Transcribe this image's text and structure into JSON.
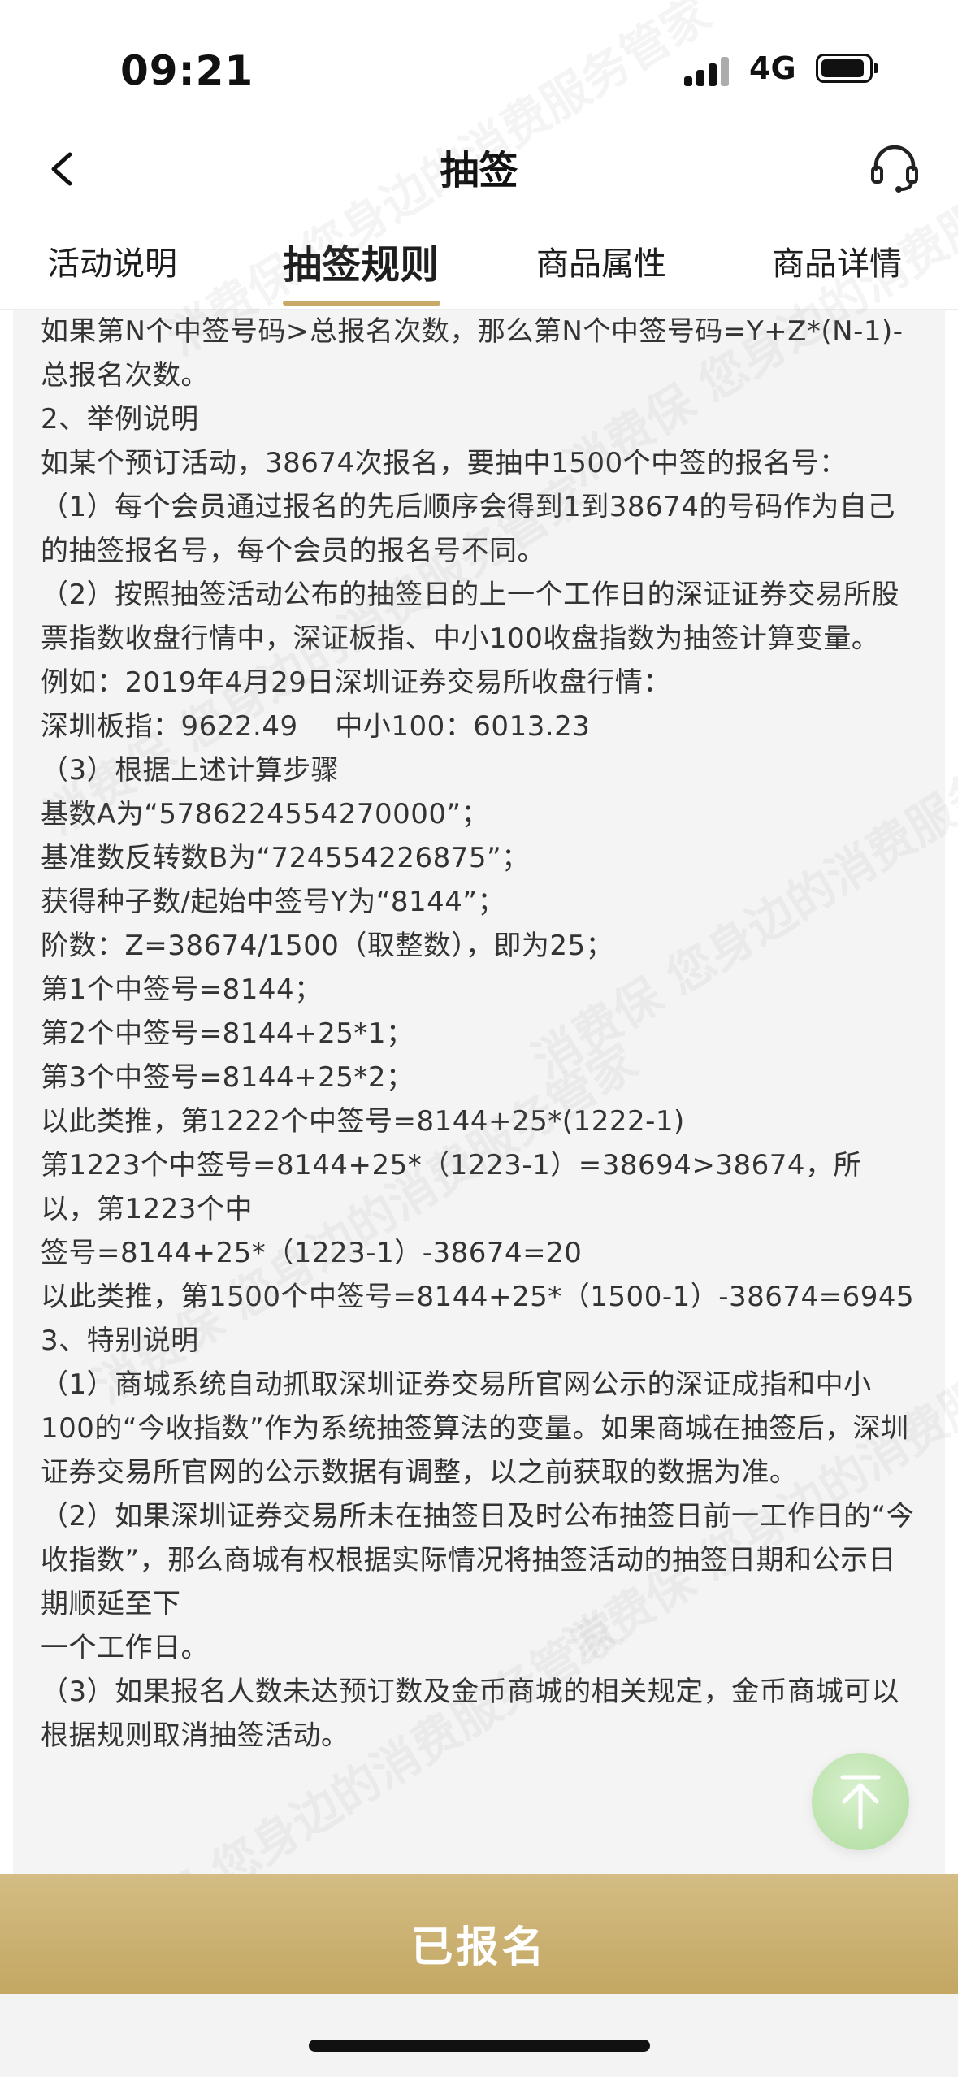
{
  "status_bar": {
    "time": "09:21",
    "network": "4G"
  },
  "nav": {
    "title": "抽签"
  },
  "tabs": [
    {
      "label": "活动说明",
      "active": false
    },
    {
      "label": "抽签规则",
      "active": true
    },
    {
      "label": "商品属性",
      "active": false
    },
    {
      "label": "商品详情",
      "active": false
    }
  ],
  "content": {
    "paragraphs": [
      "如果第N个中签号码>总报名次数，那么第N个中签号码=Y+Z*(N-1)-总报名次数。",
      "2、举例说明",
      "如某个预订活动，38674次报名，要抽中1500个中签的报名号：",
      "（1）每个会员通过报名的先后顺序会得到1到38674的号码作为自己的抽签报名号，每个会员的报名号不同。",
      "（2）按照抽签活动公布的抽签日的上一个工作日的深证证券交易所股票指数收盘行情中，深证板指、中小100收盘指数为抽签计算变量。",
      "例如：2019年4月29日深圳证券交易所收盘行情：",
      "深圳板指：9622.49　 中小100：6013.23",
      "（3）根据上述计算步骤",
      "基数A为“5786224554270000”；",
      "基准数反转数B为“724554226875”；",
      "获得种子数/起始中签号Y为“8144”；",
      "阶数：Z=38674/1500（取整数），即为25；",
      "第1个中签号=8144；",
      "第2个中签号=8144+25*1；",
      "第3个中签号=8144+25*2；",
      "以此类推，第1222个中签号=8144+25*(1222-1)",
      "第1223个中签号=8144+25*（1223-1）=38694>38674，所以，第1223个中",
      "签号=8144+25*（1223-1）-38674=20",
      "以此类推，第1500个中签号=8144+25*（1500-1）-38674=6945",
      "3、特别说明",
      "（1）商城系统自动抓取深圳证券交易所官网公示的深证成指和中小100的“今收指数”作为系统抽签算法的变量。如果商城在抽签后，深圳证券交易所官网的公示数据有调整，以之前获取的数据为准。",
      "（2）如果深圳证券交易所未在抽签日及时公布抽签日前一工作日的“今收指数”，那么商城有权根据实际情况将抽签活动的抽签日期和公示日期顺延至下",
      "一个工作日。",
      "（3）如果报名人数未达预订数及金币商城的相关规定，金币商城可以根据规则取消抽签活动。"
    ]
  },
  "watermark": {
    "text": "消费保 您身边的消费服务管家"
  },
  "action": {
    "label": "已报名"
  },
  "icons": {
    "back": "chevron-left-icon",
    "service": "headset-icon",
    "top": "arrow-up-icon"
  },
  "colors": {
    "accent": "#c8a968",
    "action_bar": "#c9ae6e",
    "content_bg": "#f4f4f4",
    "top_button": "#bfe4b0"
  }
}
